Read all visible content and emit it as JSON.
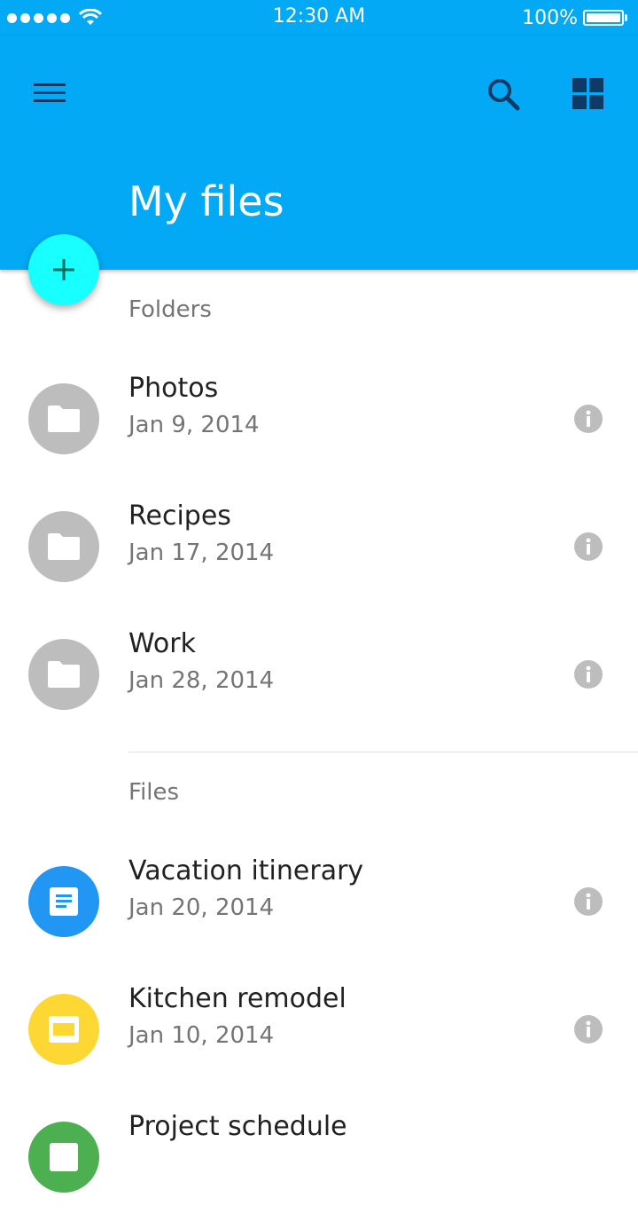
{
  "status_bar": {
    "time": "12:30 AM",
    "battery": "100%",
    "signal_icon": "signal-dots-icon",
    "wifi_icon": "wifi-icon",
    "battery_icon": "battery-icon"
  },
  "app_bar": {
    "title": "My files",
    "background_color": "#03a9f4",
    "menu_icon": "menu-icon",
    "search_icon": "search-icon",
    "view_icon": "grid-view-icon"
  },
  "fab": {
    "icon": "plus-icon",
    "color": "#18ffff"
  },
  "folders": {
    "header": "Folders",
    "items": [
      {
        "name": "Photos",
        "date": "Jan 9, 2014",
        "icon": "folder-icon",
        "color": "#bdbdbd"
      },
      {
        "name": "Recipes",
        "date": "Jan 17, 2014",
        "icon": "folder-icon",
        "color": "#bdbdbd"
      },
      {
        "name": "Work",
        "date": "Jan 28, 2014",
        "icon": "folder-icon",
        "color": "#bdbdbd"
      }
    ]
  },
  "files": {
    "header": "Files",
    "items": [
      {
        "name": "Vacation itinerary",
        "date": "Jan 20, 2014",
        "icon": "document-icon",
        "color": "#2196f3"
      },
      {
        "name": "Kitchen remodel",
        "date": "Jan 10, 2014",
        "icon": "slides-icon",
        "color": "#fdd835"
      },
      {
        "name": "Project schedule",
        "date": "",
        "icon": "spreadsheet-icon",
        "color": "#4caf50"
      }
    ]
  }
}
